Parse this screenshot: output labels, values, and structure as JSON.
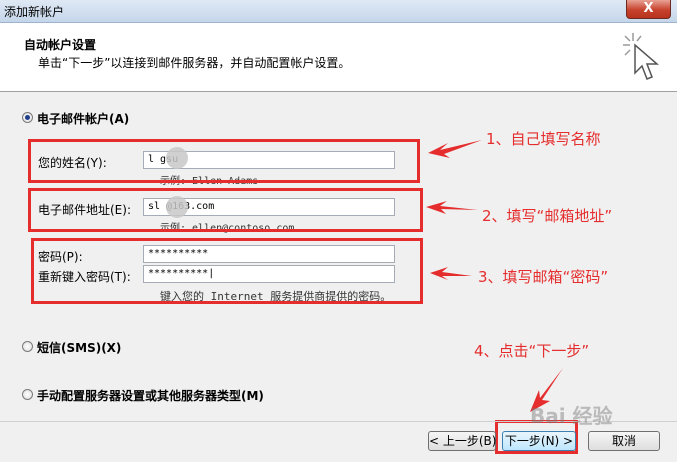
{
  "window": {
    "title": "添加新帐户",
    "close_label": "X"
  },
  "header": {
    "title": "自动帐户设置",
    "description": "单击“下一步”以连接到邮件服务器，并自动配置帐户设置。"
  },
  "email_account": {
    "option_label": "电子邮件帐户(A)",
    "name_label": "您的姓名(Y):",
    "name_value": "l    gsu",
    "name_hint": "示例: Ellen Adams",
    "email_label": "电子邮件地址(E):",
    "email_value": "sl     @163.com",
    "email_hint": "示例: ellen@contoso.com",
    "password_label": "密码(P):",
    "password_value": "**********",
    "retype_label": "重新键入密码(T):",
    "retype_value": "**********|",
    "password_hint": "键入您的 Internet 服务提供商提供的密码。"
  },
  "sms_option": {
    "label": "短信(SMS)(X)"
  },
  "manual_option": {
    "label": "手动配置服务器设置或其他服务器类型(M)"
  },
  "annotations": {
    "step1": "1、自己填写名称",
    "step2": "2、填写“邮箱地址”",
    "step3": "3、填写邮箱“密码”",
    "step4": "4、点击“下一步”"
  },
  "buttons": {
    "back": "< 上一步(B)",
    "next": "下一步(N) >",
    "cancel": "取消"
  },
  "watermark": "Bai 经验",
  "colors": {
    "annotation_red": "#e52d2d",
    "header_bg": "#ffffff",
    "dialog_bg": "#f0f0f0"
  }
}
